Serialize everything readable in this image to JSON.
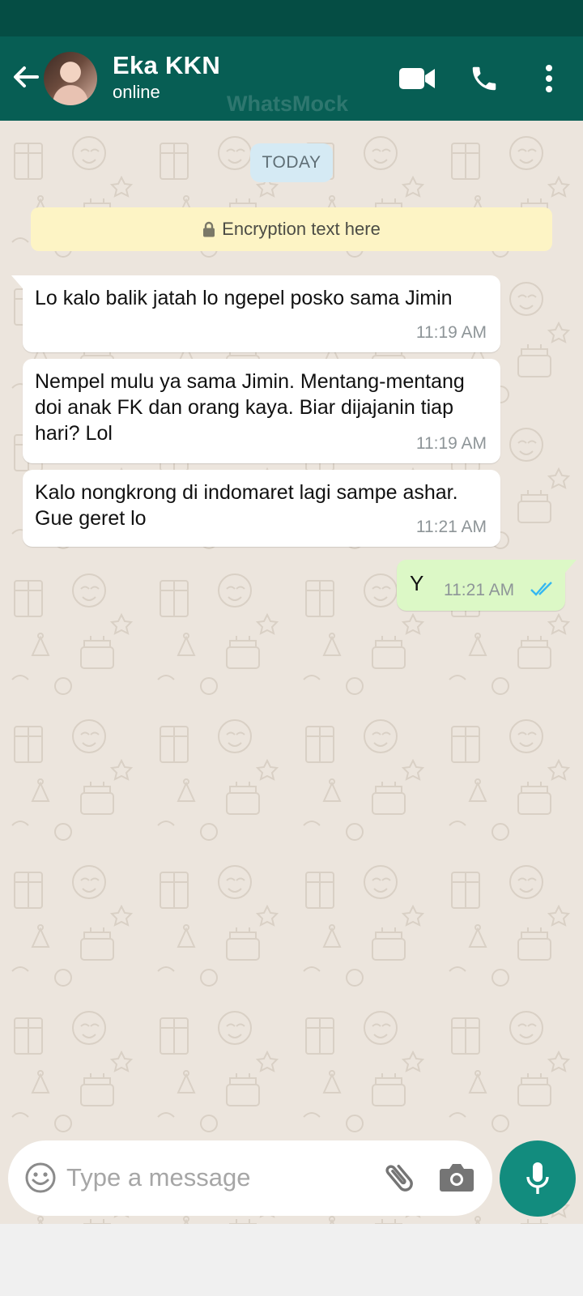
{
  "header": {
    "contact_name": "Eka KKN",
    "contact_status": "online",
    "watermark": "WhatsMock",
    "icons": [
      "arrow-back-icon",
      "videocam-icon",
      "phone-icon",
      "more-vert-icon"
    ],
    "background_color": "#075e54"
  },
  "chat": {
    "date_label": "TODAY",
    "encryption_notice": "Encryption text here",
    "messages": [
      {
        "direction": "in",
        "text": "Lo kalo balik jatah lo ngepel posko sama Jimin",
        "time": "11:19 AM"
      },
      {
        "direction": "in",
        "text": "Nempel mulu ya sama Jimin. Mentang-mentang doi anak FK dan orang kaya. Biar dijajanin tiap hari? Lol",
        "time": "11:19 AM"
      },
      {
        "direction": "in",
        "text": "Kalo nongkrong di indomaret lagi sampe ashar. Gue geret lo",
        "time": "11:21 AM"
      },
      {
        "direction": "out",
        "text": "Y",
        "time": "11:21 AM",
        "status": "read"
      }
    ],
    "wallpaper_color": "#ece5dd",
    "outgoing_bubble_color": "#dcf8c6"
  },
  "composer": {
    "placeholder": "Type a message",
    "value": "",
    "icons": [
      "emoji-icon",
      "attach-icon",
      "camera-icon",
      "mic-icon"
    ],
    "accent_color": "#128c7e"
  }
}
